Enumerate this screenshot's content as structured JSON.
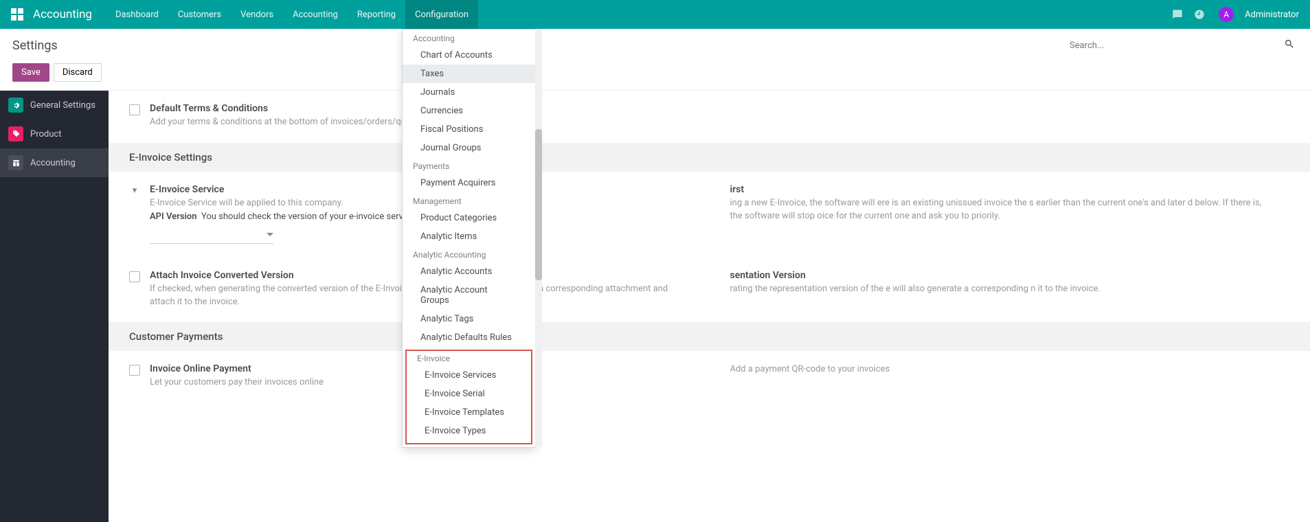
{
  "brand": "Accounting",
  "nav": [
    "Dashboard",
    "Customers",
    "Vendors",
    "Accounting",
    "Reporting",
    "Configuration"
  ],
  "nav_active": "Configuration",
  "user": {
    "avatar": "A",
    "name": "Administrator"
  },
  "page_title": "Settings",
  "search": {
    "placeholder": "Search..."
  },
  "actions": {
    "save": "Save",
    "discard": "Discard"
  },
  "sidebar": [
    {
      "label": "General Settings",
      "icon": "gear"
    },
    {
      "label": "Product",
      "icon": "tag"
    },
    {
      "label": "Accounting",
      "icon": "acc"
    }
  ],
  "sidebar_active": 2,
  "sections": {
    "terms": {
      "title": "Default Terms & Conditions",
      "desc": "Add your terms & conditions at the bottom of invoices/orders/quotations"
    },
    "einvoice_section": "E-Invoice Settings",
    "service": {
      "title": "E-Invoice Service",
      "desc": "E-Invoice Service will be applied to this company.",
      "api_label": "API Version",
      "api_desc": "You should check the version of your e-invoice service before choosing versions here"
    },
    "check_first": {
      "title_suffix": "irst",
      "desc": "ing a new E-Invoice, the software will ere is an existing unissued invoice the s earlier than the current one's and later d below. If there is, the software will stop oice for the current one and ask you to priorily."
    },
    "attach": {
      "title": "Attach Invoice Converted Version",
      "desc": "If checked, when generating the converted version of the E-Invoice, the software will also generate a corresponding attachment and attach it to the invoice."
    },
    "repr": {
      "title_suffix": "sentation Version",
      "desc": "rating the representation version of the e will also generate a corresponding n it to the invoice."
    },
    "cust_pay_section": "Customer Payments",
    "online": {
      "title": "Invoice Online Payment",
      "desc": "Let your customers pay their invoices online"
    },
    "qr": {
      "desc": "Add a payment QR-code to your invoices"
    }
  },
  "dropdown": {
    "accounting": {
      "label": "Accounting",
      "items": [
        "Chart of Accounts",
        "Taxes",
        "Journals",
        "Currencies",
        "Fiscal Positions",
        "Journal Groups"
      ],
      "hl": "Taxes"
    },
    "payments": {
      "label": "Payments",
      "items": [
        "Payment Acquirers"
      ]
    },
    "management": {
      "label": "Management",
      "items": [
        "Product Categories",
        "Analytic Items"
      ]
    },
    "analytic": {
      "label": "Analytic Accounting",
      "items": [
        "Analytic Accounts",
        "Analytic Account Groups",
        "Analytic Tags",
        "Analytic Defaults Rules"
      ]
    },
    "einvoice": {
      "label": "E-Invoice",
      "items": [
        "E-Invoice Services",
        "E-Invoice Serial",
        "E-Invoice Templates",
        "E-Invoice Types"
      ]
    }
  }
}
